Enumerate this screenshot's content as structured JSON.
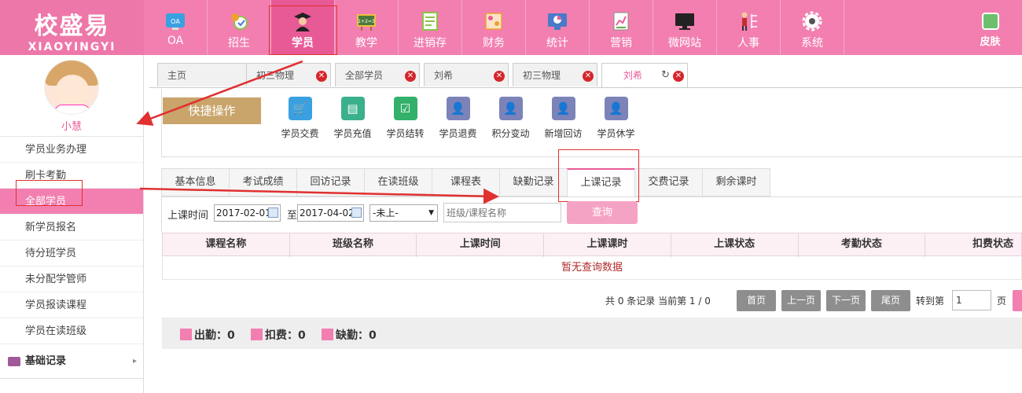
{
  "logo": {
    "cn": "校盛易",
    "en": "XIAOYINGYI"
  },
  "nav": [
    {
      "label": "OA",
      "icon": "oa-icon",
      "color": "#3aa0e0"
    },
    {
      "label": "招生",
      "icon": "recruit-icon",
      "color": "#8bc34a"
    },
    {
      "label": "学员",
      "icon": "student-icon",
      "color": "#333333"
    },
    {
      "label": "教学",
      "icon": "teaching-board-icon",
      "color": "#6a9a3a"
    },
    {
      "label": "进销存",
      "icon": "inventory-icon",
      "color": "#8bc34a"
    },
    {
      "label": "财务",
      "icon": "finance-icon",
      "color": "#f0a030"
    },
    {
      "label": "统计",
      "icon": "statistics-icon",
      "color": "#4a7ac8"
    },
    {
      "label": "营销",
      "icon": "marketing-icon",
      "color": "#6ab04c"
    },
    {
      "label": "微网站",
      "icon": "monitor-icon",
      "color": "#222222"
    },
    {
      "label": "人事",
      "icon": "personnel-icon",
      "color": "#555555"
    },
    {
      "label": "系统",
      "icon": "gear-icon",
      "color": "#555555"
    }
  ],
  "skin": {
    "label": "皮肤"
  },
  "user": {
    "name": "小慧"
  },
  "sidebar": {
    "items": [
      {
        "label": "学员业务办理"
      },
      {
        "label": "刷卡考勤"
      },
      {
        "label": "全部学员"
      },
      {
        "label": "新学员报名"
      },
      {
        "label": "待分班学员"
      },
      {
        "label": "未分配学管师"
      },
      {
        "label": "学员报读课程"
      },
      {
        "label": "学员在读班级"
      }
    ],
    "group": "基础记录"
  },
  "page_tabs": [
    {
      "label": "主页"
    },
    {
      "label": "初三物理"
    },
    {
      "label": "全部学员"
    },
    {
      "label": "刘希"
    },
    {
      "label": "初三物理"
    },
    {
      "label": "刘希"
    }
  ],
  "quick": {
    "label": "快捷操作",
    "ops": [
      {
        "label": "学员交费",
        "icon": "cart-icon",
        "color": "#3aa0e0"
      },
      {
        "label": "学员充值",
        "icon": "store-icon",
        "color": "#3ab08c"
      },
      {
        "label": "学员结转",
        "icon": "transfer-icon",
        "color": "#33b06a"
      },
      {
        "label": "学员退费",
        "icon": "user-refund-icon",
        "color": "#7c83b8"
      },
      {
        "label": "积分变动",
        "icon": "user-points-icon",
        "color": "#7c83b8"
      },
      {
        "label": "新增回访",
        "icon": "user-visit-icon",
        "color": "#7c83b8"
      },
      {
        "label": "学员休学",
        "icon": "user-suspend-icon",
        "color": "#7c83b8"
      }
    ]
  },
  "detail_tabs": [
    {
      "label": "基本信息"
    },
    {
      "label": "考试成绩"
    },
    {
      "label": "回访记录"
    },
    {
      "label": "在读班级"
    },
    {
      "label": "课程表"
    },
    {
      "label": "缺勤记录"
    },
    {
      "label": "上课记录"
    },
    {
      "label": "交费记录"
    },
    {
      "label": "剩余课时"
    }
  ],
  "filter": {
    "time_label": "上课时间",
    "date_from": "2017-02-01",
    "to_label": "至",
    "date_to": "2017-04-02",
    "status_value": "-未上-",
    "search_placeholder": "班级/课程名称",
    "query_label": "查询"
  },
  "table": {
    "headers": [
      "课程名称",
      "班级名称",
      "上课时间",
      "上课课时",
      "上课状态",
      "考勤状态",
      "扣费状态"
    ],
    "empty_text": "暂无查询数据"
  },
  "pager": {
    "info": "共 0 条记录 当前第 1 / 0",
    "first": "首页",
    "prev": "上一页",
    "next": "下一页",
    "last": "尾页",
    "jump_label": "转到第",
    "jump_value": "1",
    "page_label": "页"
  },
  "summary": {
    "attend": "出勤：0",
    "deduct": "扣费：0",
    "absent": "缺勤：0"
  },
  "colors": {
    "brand_pink": "#f27fb0",
    "active_pink": "#e85a96",
    "annotation_red": "#e03030"
  }
}
